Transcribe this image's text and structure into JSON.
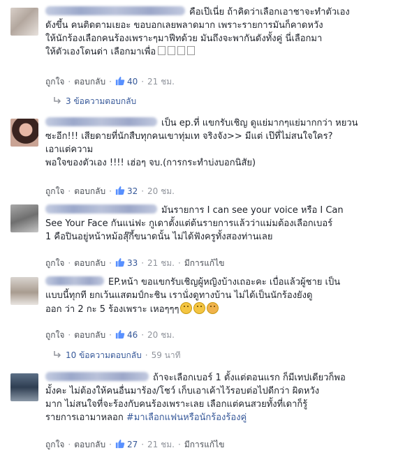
{
  "actions": {
    "like": "ถูกใจ",
    "reply": "ตอบกลับ",
    "edited": "มีการแก้ไข"
  },
  "comments": [
    {
      "text": "คือเป๊เนี่ย ถ้าคิดว่าเลือกเอาชาจะทำตัวเอง\nดังขึ้น คนติดตามเยอะ ขอบอกเลยพลาดมาก เพราะรายการมันก็คาดหวัง\nให้นักร้องเลือกคนร้องเพราะๆมาฟีทด้วย มันถึงจะพากันดังทั้งคู่ นี่เลือกมา\nให้ตัวเองโดนด่า เลือกมาเพื่อ",
      "likes": "40",
      "time": "21 ชม.",
      "replies": "3 ข้อความตอบกลับ"
    },
    {
      "text": "เป็น ep.ที่ แขกรับเชิญ ดูแย่มากๆแย่มากกว่า หยวน\nซะอีก!!! เสียดายที่นักสืบทุกคนเขาทุ่มเท จริงจัง>> มีแต่ เป๊ที่ไม่สนใจใคร?\nเอาแต่ความ\nพอใจของตัวเอง !!!! เฮ่อๆ จบ.(การกระทำบ่งบอกนิสัย)",
      "likes": "32",
      "time": "20 ชม."
    },
    {
      "text": "มันรายการ I can see your voice หรือ I Can\nSee Your Face กันแน่ฟะ กูเดาตั้งแต่ต้นรายการแล้วว่าแม่มต้องเลือกเบอร์\n1 คือปินอยู่หน้าหม้อสุ๊กี้ขนาดนั้น ไม่ได้ฟังครูทั้งสองท่านเลย",
      "likes": "33",
      "time": "21 ชม."
    },
    {
      "text": "EP.หน้า ขอแขกรับเชิญผู้หญิงบ้างเถอะคะ เบื่อแล้วผู้ชาย เป็น\nแบบนี้ทุกที ยกเว้นแสตมป์กะชิน เรานั่งดูทางบ้าน ไม่ได้เป็นนักร้องยังดู\nออก ว่า 2 กะ 5 ร้องเพราะ เหอๆๆๆ",
      "likes": "46",
      "time": "20 ชม.",
      "replies": "10 ข้อความตอบกลับ",
      "replies_time": "59 นาที"
    },
    {
      "text": "ถ้าจะเลือกเบอร์ 1 ตั้งแต่ตอนแรก ก็มีเทปเดียวก็พอ\nมั้งคะ ไม่ต้องให้คนอื่นมาร้อง/โชว์ เก็บเอาเค้าไว้รอบต่อไปดีกว่า ผิดหวัง\nมาก ไม่สนใจที่จะร้องกับคนร้องเพราะเลย เลือกแต่คนสวยทั้งที่เดาก็รู้\nรายการเอามาหลอก",
      "hashtag": "#มาเลือกแฟนหรือนักร้องร้องคู่",
      "likes": "27",
      "time": "21 ชม."
    }
  ]
}
